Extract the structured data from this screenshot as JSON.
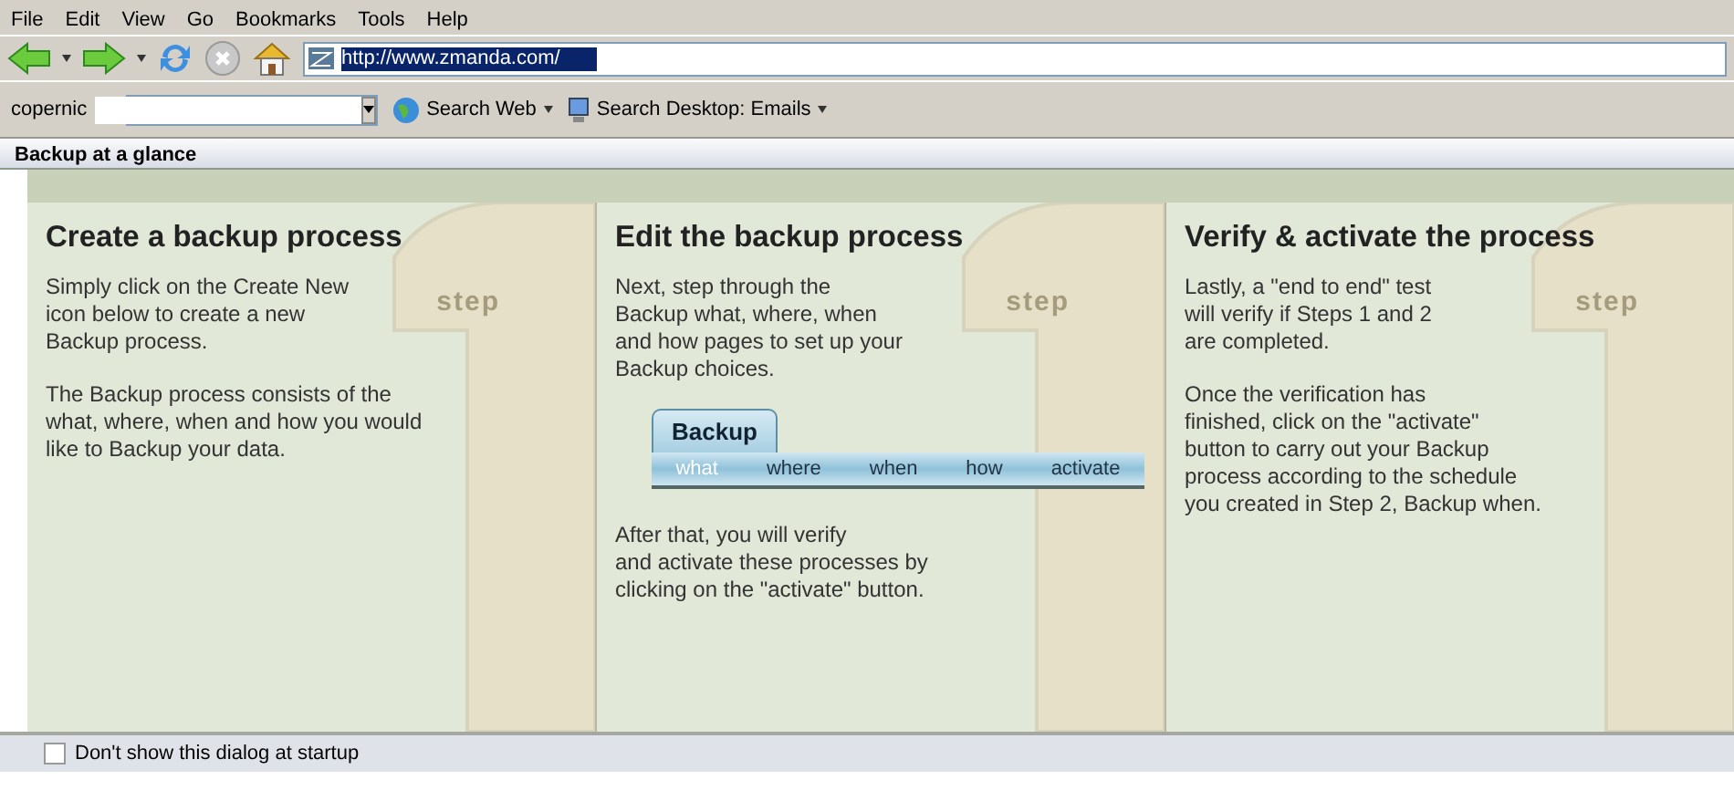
{
  "menu": [
    "File",
    "Edit",
    "View",
    "Go",
    "Bookmarks",
    "Tools",
    "Help"
  ],
  "address": {
    "value": "http://www.zmanda.com/"
  },
  "search_toolbar": {
    "brand": "copernic",
    "buttons": [
      "Search Web",
      "Search Desktop: Emails"
    ]
  },
  "dialog": {
    "title": "Backup at a glance",
    "steps": [
      {
        "label": "step",
        "heading": "Create a backup process",
        "paragraphs": [
          "Simply click on the Create New\nicon below to create a new\nBackup process.",
          "The Backup process consists of the\nwhat, where, when and how you would\nlike to Backup your data."
        ]
      },
      {
        "label": "step",
        "heading": "Edit the backup process",
        "paragraphs": [
          "Next, step through the\nBackup what, where, when\nand how pages to set up your\nBackup choices."
        ],
        "tab_strip": {
          "tab": "Backup",
          "items": [
            {
              "label": "what",
              "selected": true
            },
            {
              "label": "where",
              "selected": false
            },
            {
              "label": "when",
              "selected": false
            },
            {
              "label": "how",
              "selected": false
            },
            {
              "label": "activate",
              "selected": false
            }
          ]
        },
        "after": "After that, you will verify\nand activate these processes by\nclicking on the \"activate\" button."
      },
      {
        "label": "step",
        "heading": "Verify & activate the process",
        "paragraphs": [
          "Lastly, a \"end to end\" test\nwill verify if Steps 1 and 2\nare completed.",
          "Once the verification has\nfinished, click on the \"activate\"\nbutton to carry out your Backup\nprocess according to the schedule\nyou created in Step 2, Backup when."
        ]
      }
    ],
    "startup_checkbox": {
      "label": "Don't show this dialog at startup",
      "checked": false
    }
  }
}
